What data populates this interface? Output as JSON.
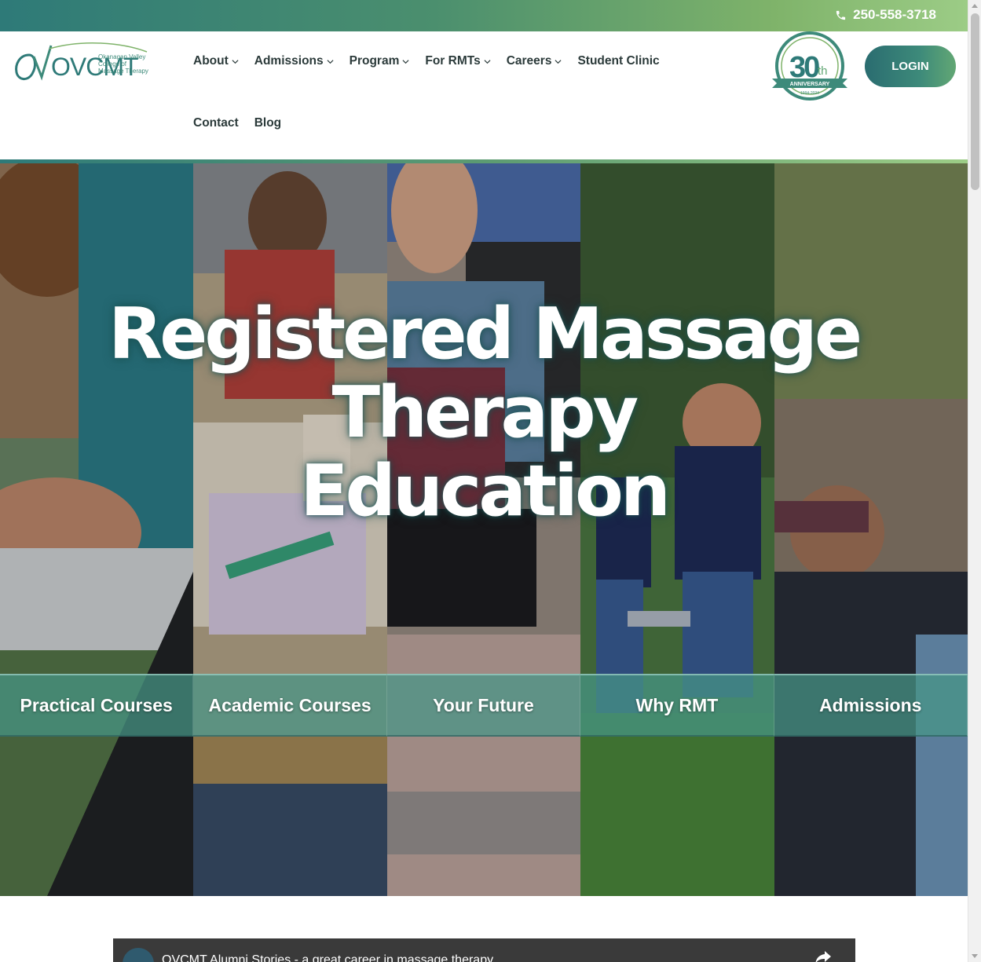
{
  "topbar": {
    "phone": "250-558-3718",
    "phone_icon": "phone-icon"
  },
  "header": {
    "logo": {
      "mark": "OVCMT",
      "line1": "Okanagan Valley",
      "line2": "College of",
      "line3": "Massage Therapy"
    },
    "nav_row1": [
      {
        "label": "About",
        "dropdown": true
      },
      {
        "label": "Admissions",
        "dropdown": true
      },
      {
        "label": "Program",
        "dropdown": true
      },
      {
        "label": "For RMTs",
        "dropdown": true
      },
      {
        "label": "Careers",
        "dropdown": true
      },
      {
        "label": "Student Clinic",
        "dropdown": false
      }
    ],
    "nav_row2": [
      {
        "label": "Contact"
      },
      {
        "label": "Blog"
      }
    ],
    "badge": {
      "number": "30",
      "suffix": "th",
      "ribbon": "ANNIVERSARY",
      "years": "1994-2024"
    },
    "login_label": "LOGIN"
  },
  "hero": {
    "title_line1": "Registered Massage Therapy",
    "title_line2": "Education",
    "tabs": [
      "Practical Courses",
      "Academic Courses",
      "Your Future",
      "Why RMT",
      "Admissions"
    ]
  },
  "video": {
    "title": "OVCMT Alumni Stories - a great career in massage therapy",
    "share_icon": "share-icon"
  },
  "colors": {
    "brand_teal": "#2e7a78",
    "brand_green": "#9ccc86",
    "tab_overlay": "#46968a",
    "nav_text": "#2b3a3a"
  }
}
